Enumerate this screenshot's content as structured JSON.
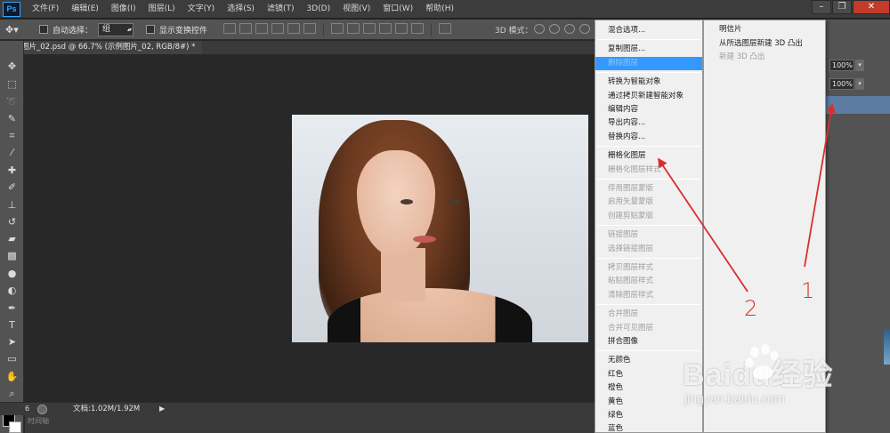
{
  "app": {
    "logo_text": "Ps"
  },
  "menubar": {
    "items": [
      "文件(F)",
      "编辑(E)",
      "图像(I)",
      "图层(L)",
      "文字(Y)",
      "选择(S)",
      "滤镜(T)",
      "3D(D)",
      "视图(V)",
      "窗口(W)",
      "帮助(H)"
    ],
    "window_controls": [
      "–",
      "❐",
      "✕"
    ]
  },
  "options_bar": {
    "auto_select_label": "自动选择：",
    "auto_select_value": "组",
    "show_transform_label": "显示变换控件",
    "mode_3d_label": "3D 模式："
  },
  "document": {
    "tab_title": "图片_02.psd @ 66.7% (示例图片_02, RGB/8#) *"
  },
  "status": {
    "zoom": "6",
    "doc_size": "文档:1.02M/1.92M",
    "arrow": "▶",
    "timeline_label": "时间轴"
  },
  "right_panel": {
    "opacity_value": "100%",
    "fill_value": "100%"
  },
  "context_menu": {
    "items": [
      {
        "label": "混合选项...",
        "state": "normal"
      },
      {
        "sep": true
      },
      {
        "label": "复制图层...",
        "state": "normal"
      },
      {
        "label": "删除图层",
        "state": "selected"
      },
      {
        "sep": true
      },
      {
        "label": "转换为智能对象",
        "state": "normal"
      },
      {
        "label": "通过拷贝新建智能对象",
        "state": "normal"
      },
      {
        "label": "编辑内容",
        "state": "normal"
      },
      {
        "label": "导出内容...",
        "state": "normal"
      },
      {
        "label": "替换内容...",
        "state": "normal"
      },
      {
        "sep": true
      },
      {
        "label": "栅格化图层",
        "state": "normal"
      },
      {
        "label": "栅格化图层样式",
        "state": "disabled"
      },
      {
        "sep": true
      },
      {
        "label": "停用图层蒙版",
        "state": "disabled"
      },
      {
        "label": "启用矢量蒙版",
        "state": "disabled"
      },
      {
        "label": "创建剪贴蒙版",
        "state": "disabled"
      },
      {
        "sep": true
      },
      {
        "label": "链接图层",
        "state": "disabled"
      },
      {
        "label": "选择链接图层",
        "state": "disabled"
      },
      {
        "sep": true
      },
      {
        "label": "拷贝图层样式",
        "state": "disabled"
      },
      {
        "label": "粘贴图层样式",
        "state": "disabled"
      },
      {
        "label": "清除图层样式",
        "state": "disabled"
      },
      {
        "sep": true
      },
      {
        "label": "合并图层",
        "state": "disabled"
      },
      {
        "label": "合并可见图层",
        "state": "disabled"
      },
      {
        "label": "拼合图像",
        "state": "normal"
      },
      {
        "sep": true
      },
      {
        "label": "无颜色",
        "state": "normal"
      },
      {
        "label": "红色",
        "state": "normal"
      },
      {
        "label": "橙色",
        "state": "normal"
      },
      {
        "label": "黄色",
        "state": "normal"
      },
      {
        "label": "绿色",
        "state": "normal"
      },
      {
        "label": "蓝色",
        "state": "normal"
      }
    ]
  },
  "submenu": {
    "items": [
      {
        "label": "明信片",
        "state": "normal"
      },
      {
        "label": "从所选图层新建 3D 凸出",
        "state": "normal"
      },
      {
        "label": "新建 3D 凸出",
        "state": "disabled"
      }
    ]
  },
  "annotations": {
    "label_1": "1",
    "label_2": "2",
    "color": "#d82e2e"
  },
  "watermark": {
    "text": "Baidu经验",
    "url": "jingyan.baidu.com"
  }
}
